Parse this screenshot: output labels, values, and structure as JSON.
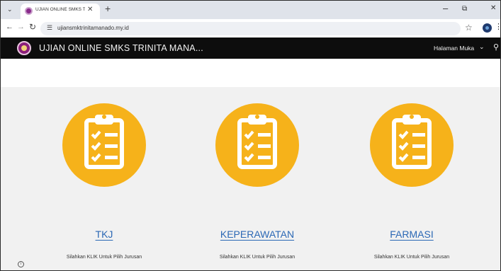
{
  "browser": {
    "tab_title": "UJIAN ONLINE SMKS TRINITA",
    "tab_menu_icon": "chevron-down-icon",
    "new_tab_icon": "plus-icon",
    "url": "ujiansmktrinitamanado.my.id"
  },
  "site": {
    "title": "UJIAN ONLINE SMKS TRINITA MANA...",
    "menu_label": "Halaman Muka",
    "brand_color": "#0d0d0d",
    "accent_color": "#f6b21a",
    "link_color": "#2b68b5"
  },
  "cards": [
    {
      "name": "TKJ",
      "subtitle": "Silahkan KLIK Untuk Pilih Jurusan",
      "icon": "clipboard-checklist-icon"
    },
    {
      "name": "KEPERAWATAN",
      "subtitle": "Silahkan KLIK Untuk Pilih Jurusan",
      "icon": "clipboard-checklist-icon"
    },
    {
      "name": "FARMASI",
      "subtitle": "Silahkan KLIK Untuk Pilih Jurusan",
      "icon": "clipboard-checklist-icon"
    }
  ]
}
